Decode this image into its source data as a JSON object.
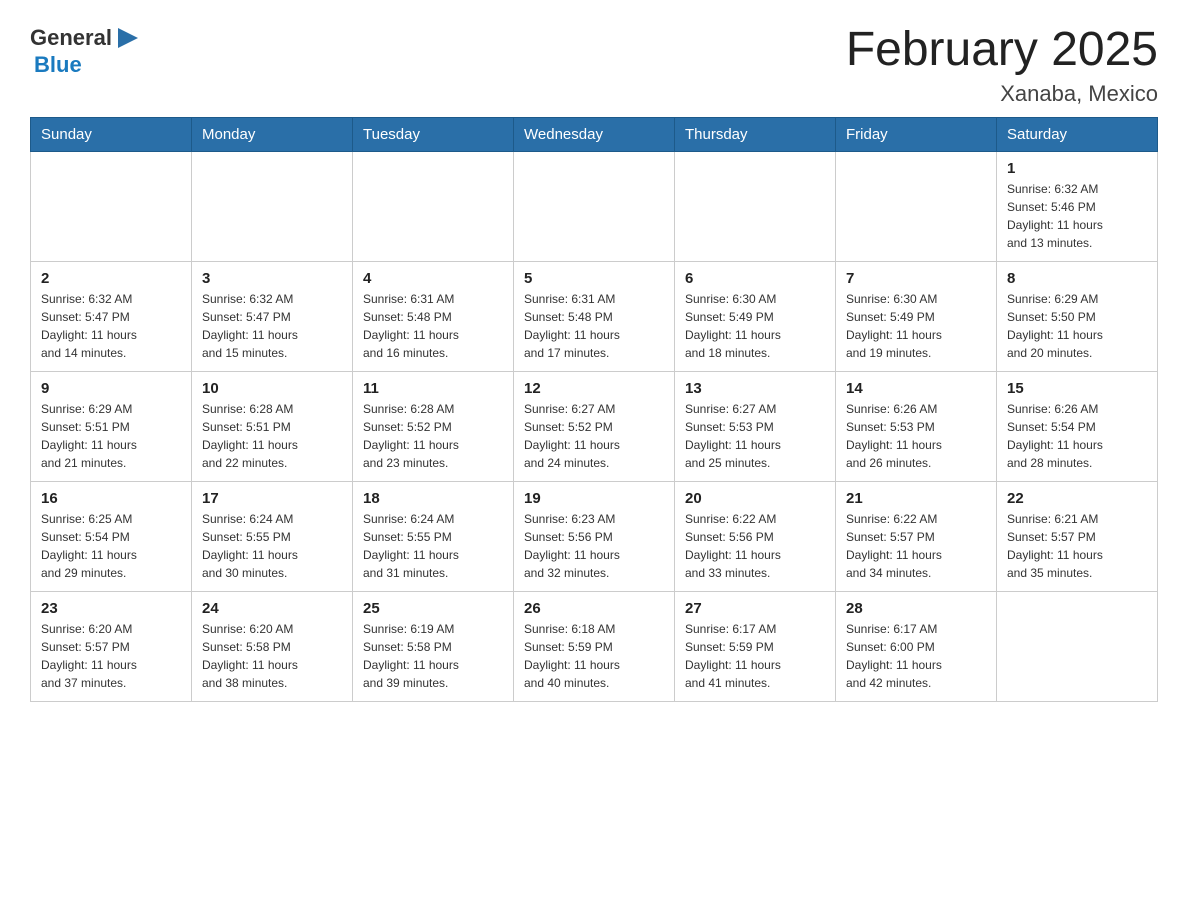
{
  "header": {
    "logo": {
      "general": "General",
      "triangle_icon": "▶",
      "blue": "Blue"
    },
    "title": "February 2025",
    "subtitle": "Xanaba, Mexico"
  },
  "days_of_week": [
    "Sunday",
    "Monday",
    "Tuesday",
    "Wednesday",
    "Thursday",
    "Friday",
    "Saturday"
  ],
  "weeks": [
    {
      "days": [
        {
          "num": "",
          "info": ""
        },
        {
          "num": "",
          "info": ""
        },
        {
          "num": "",
          "info": ""
        },
        {
          "num": "",
          "info": ""
        },
        {
          "num": "",
          "info": ""
        },
        {
          "num": "",
          "info": ""
        },
        {
          "num": "1",
          "info": "Sunrise: 6:32 AM\nSunset: 5:46 PM\nDaylight: 11 hours\nand 13 minutes."
        }
      ]
    },
    {
      "days": [
        {
          "num": "2",
          "info": "Sunrise: 6:32 AM\nSunset: 5:47 PM\nDaylight: 11 hours\nand 14 minutes."
        },
        {
          "num": "3",
          "info": "Sunrise: 6:32 AM\nSunset: 5:47 PM\nDaylight: 11 hours\nand 15 minutes."
        },
        {
          "num": "4",
          "info": "Sunrise: 6:31 AM\nSunset: 5:48 PM\nDaylight: 11 hours\nand 16 minutes."
        },
        {
          "num": "5",
          "info": "Sunrise: 6:31 AM\nSunset: 5:48 PM\nDaylight: 11 hours\nand 17 minutes."
        },
        {
          "num": "6",
          "info": "Sunrise: 6:30 AM\nSunset: 5:49 PM\nDaylight: 11 hours\nand 18 minutes."
        },
        {
          "num": "7",
          "info": "Sunrise: 6:30 AM\nSunset: 5:49 PM\nDaylight: 11 hours\nand 19 minutes."
        },
        {
          "num": "8",
          "info": "Sunrise: 6:29 AM\nSunset: 5:50 PM\nDaylight: 11 hours\nand 20 minutes."
        }
      ]
    },
    {
      "days": [
        {
          "num": "9",
          "info": "Sunrise: 6:29 AM\nSunset: 5:51 PM\nDaylight: 11 hours\nand 21 minutes."
        },
        {
          "num": "10",
          "info": "Sunrise: 6:28 AM\nSunset: 5:51 PM\nDaylight: 11 hours\nand 22 minutes."
        },
        {
          "num": "11",
          "info": "Sunrise: 6:28 AM\nSunset: 5:52 PM\nDaylight: 11 hours\nand 23 minutes."
        },
        {
          "num": "12",
          "info": "Sunrise: 6:27 AM\nSunset: 5:52 PM\nDaylight: 11 hours\nand 24 minutes."
        },
        {
          "num": "13",
          "info": "Sunrise: 6:27 AM\nSunset: 5:53 PM\nDaylight: 11 hours\nand 25 minutes."
        },
        {
          "num": "14",
          "info": "Sunrise: 6:26 AM\nSunset: 5:53 PM\nDaylight: 11 hours\nand 26 minutes."
        },
        {
          "num": "15",
          "info": "Sunrise: 6:26 AM\nSunset: 5:54 PM\nDaylight: 11 hours\nand 28 minutes."
        }
      ]
    },
    {
      "days": [
        {
          "num": "16",
          "info": "Sunrise: 6:25 AM\nSunset: 5:54 PM\nDaylight: 11 hours\nand 29 minutes."
        },
        {
          "num": "17",
          "info": "Sunrise: 6:24 AM\nSunset: 5:55 PM\nDaylight: 11 hours\nand 30 minutes."
        },
        {
          "num": "18",
          "info": "Sunrise: 6:24 AM\nSunset: 5:55 PM\nDaylight: 11 hours\nand 31 minutes."
        },
        {
          "num": "19",
          "info": "Sunrise: 6:23 AM\nSunset: 5:56 PM\nDaylight: 11 hours\nand 32 minutes."
        },
        {
          "num": "20",
          "info": "Sunrise: 6:22 AM\nSunset: 5:56 PM\nDaylight: 11 hours\nand 33 minutes."
        },
        {
          "num": "21",
          "info": "Sunrise: 6:22 AM\nSunset: 5:57 PM\nDaylight: 11 hours\nand 34 minutes."
        },
        {
          "num": "22",
          "info": "Sunrise: 6:21 AM\nSunset: 5:57 PM\nDaylight: 11 hours\nand 35 minutes."
        }
      ]
    },
    {
      "days": [
        {
          "num": "23",
          "info": "Sunrise: 6:20 AM\nSunset: 5:57 PM\nDaylight: 11 hours\nand 37 minutes."
        },
        {
          "num": "24",
          "info": "Sunrise: 6:20 AM\nSunset: 5:58 PM\nDaylight: 11 hours\nand 38 minutes."
        },
        {
          "num": "25",
          "info": "Sunrise: 6:19 AM\nSunset: 5:58 PM\nDaylight: 11 hours\nand 39 minutes."
        },
        {
          "num": "26",
          "info": "Sunrise: 6:18 AM\nSunset: 5:59 PM\nDaylight: 11 hours\nand 40 minutes."
        },
        {
          "num": "27",
          "info": "Sunrise: 6:17 AM\nSunset: 5:59 PM\nDaylight: 11 hours\nand 41 minutes."
        },
        {
          "num": "28",
          "info": "Sunrise: 6:17 AM\nSunset: 6:00 PM\nDaylight: 11 hours\nand 42 minutes."
        },
        {
          "num": "",
          "info": ""
        }
      ]
    }
  ]
}
